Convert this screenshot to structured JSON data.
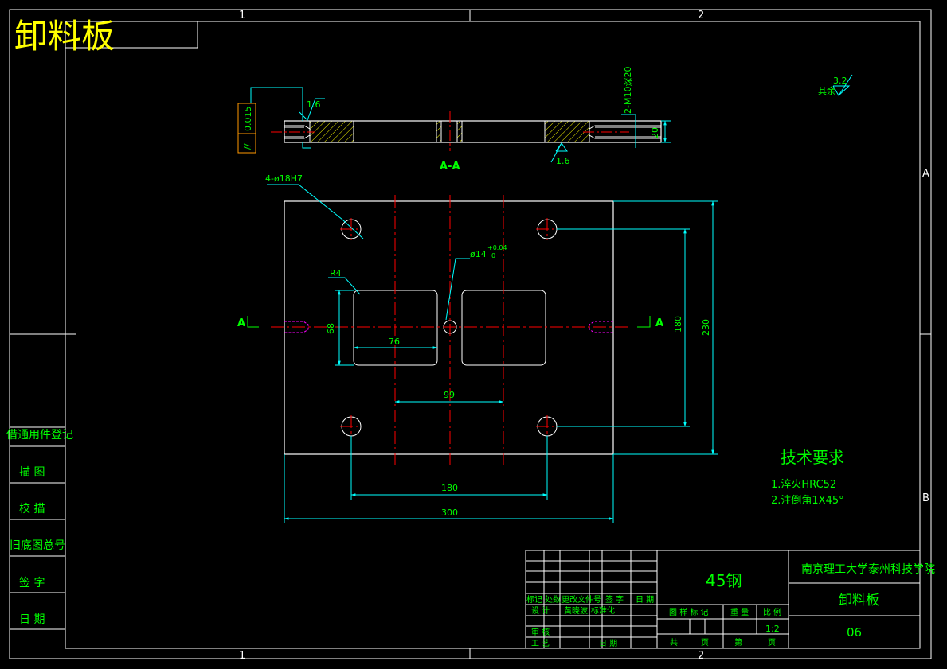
{
  "title_large": "卸料板",
  "grid": {
    "col1": "1",
    "col2": "2",
    "row_a": "A",
    "row_b": "B"
  },
  "section": {
    "label": "A-A",
    "thread_note": "2-M10深20",
    "depth_dim": "20",
    "rough_top": "1.6",
    "rough_bottom": "1.6",
    "tolerance_symbol": "//",
    "tolerance_value": "0.015"
  },
  "plan": {
    "hole_note": "4-ø18H7",
    "center_hole": "ø14",
    "center_tol_upper": "+0.04",
    "center_tol_lower": "0",
    "radius": "R4",
    "dim_76": "76",
    "dim_68": "68",
    "dim_99": "99",
    "dim_180_h": "180",
    "dim_300": "300",
    "dim_180_v": "180",
    "dim_230": "230",
    "section_mark_left": "A",
    "section_mark_right": "A"
  },
  "roughness_general": {
    "label": "其余",
    "value": "3.2"
  },
  "tech_requirements": {
    "heading": "技术要求",
    "items": [
      "1.淬火HRC52",
      "2.注倒角1X45°"
    ]
  },
  "side_table": [
    "借通用件登记",
    "描  图",
    "校  描",
    "旧底图总号",
    "签  字",
    "日  期"
  ],
  "title_block": {
    "material": "45钢",
    "school": "南京理工大学泰州科技学院",
    "part_name": "卸料板",
    "drawing_no": "06",
    "scale": "1:2",
    "rev_headers": [
      "标记",
      "处数",
      "更改文件号",
      "签  字",
      "日  期"
    ],
    "row_design": [
      "设  计",
      "黄晓波",
      "标准化"
    ],
    "row_review": "审  核",
    "row_process": "工  艺",
    "row_date": "日  期",
    "stage_label": "图 样 标 记",
    "weight_label": "重 量",
    "scale_label": "比 例",
    "total_label": "共",
    "sheet_label": "页",
    "sheet_no_label": "第",
    "page_label": "页"
  }
}
